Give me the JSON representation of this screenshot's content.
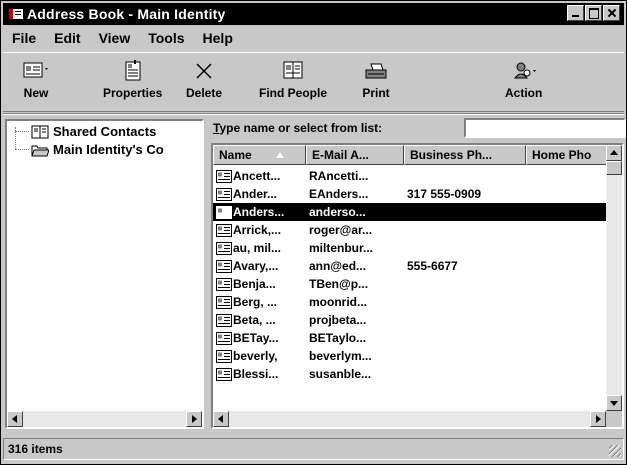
{
  "window": {
    "title": "Address Book - Main Identity"
  },
  "menu": [
    "File",
    "Edit",
    "View",
    "Tools",
    "Help"
  ],
  "toolbar": {
    "new_label": "New",
    "properties_label": "Properties",
    "delete_label": "Delete",
    "find_people_label": "Find People",
    "print_label": "Print",
    "action_label": "Action"
  },
  "folders": {
    "shared_contacts": "Shared Contacts",
    "main_identity": "Main Identity's Co"
  },
  "search": {
    "label_prefix": "T",
    "label_rest": "ype name or select from list:",
    "value": ""
  },
  "columns": [
    "Name",
    "E-Mail A...",
    "Business Ph...",
    "Home Pho"
  ],
  "contacts": [
    {
      "name": "Ancett...",
      "email": "RAncetti...",
      "business": "",
      "home": ""
    },
    {
      "name": "Ander...",
      "email": "EAnders...",
      "business": "317 555-0909",
      "home": ""
    },
    {
      "name": "Anders...",
      "email": "anderso...",
      "business": "",
      "home": ""
    },
    {
      "name": "Arrick,...",
      "email": "roger@ar...",
      "business": "",
      "home": ""
    },
    {
      "name": "au, mil...",
      "email": "miltenbur...",
      "business": "",
      "home": ""
    },
    {
      "name": "Avary,...",
      "email": "ann@ed...",
      "business": "555-6677",
      "home": ""
    },
    {
      "name": "Benja...",
      "email": "TBen@p...",
      "business": "",
      "home": ""
    },
    {
      "name": "Berg, ...",
      "email": "moonrid...",
      "business": "",
      "home": ""
    },
    {
      "name": "Beta, ...",
      "email": "projbeta...",
      "business": "",
      "home": ""
    },
    {
      "name": "BETay...",
      "email": "BETaylo...",
      "business": "",
      "home": ""
    },
    {
      "name": "beverly,",
      "email": "beverlym...",
      "business": "",
      "home": ""
    },
    {
      "name": "Blessi...",
      "email": "susanble...",
      "business": "",
      "home": ""
    }
  ],
  "selected_row_index": 2,
  "status": {
    "item_count": "316 items"
  }
}
